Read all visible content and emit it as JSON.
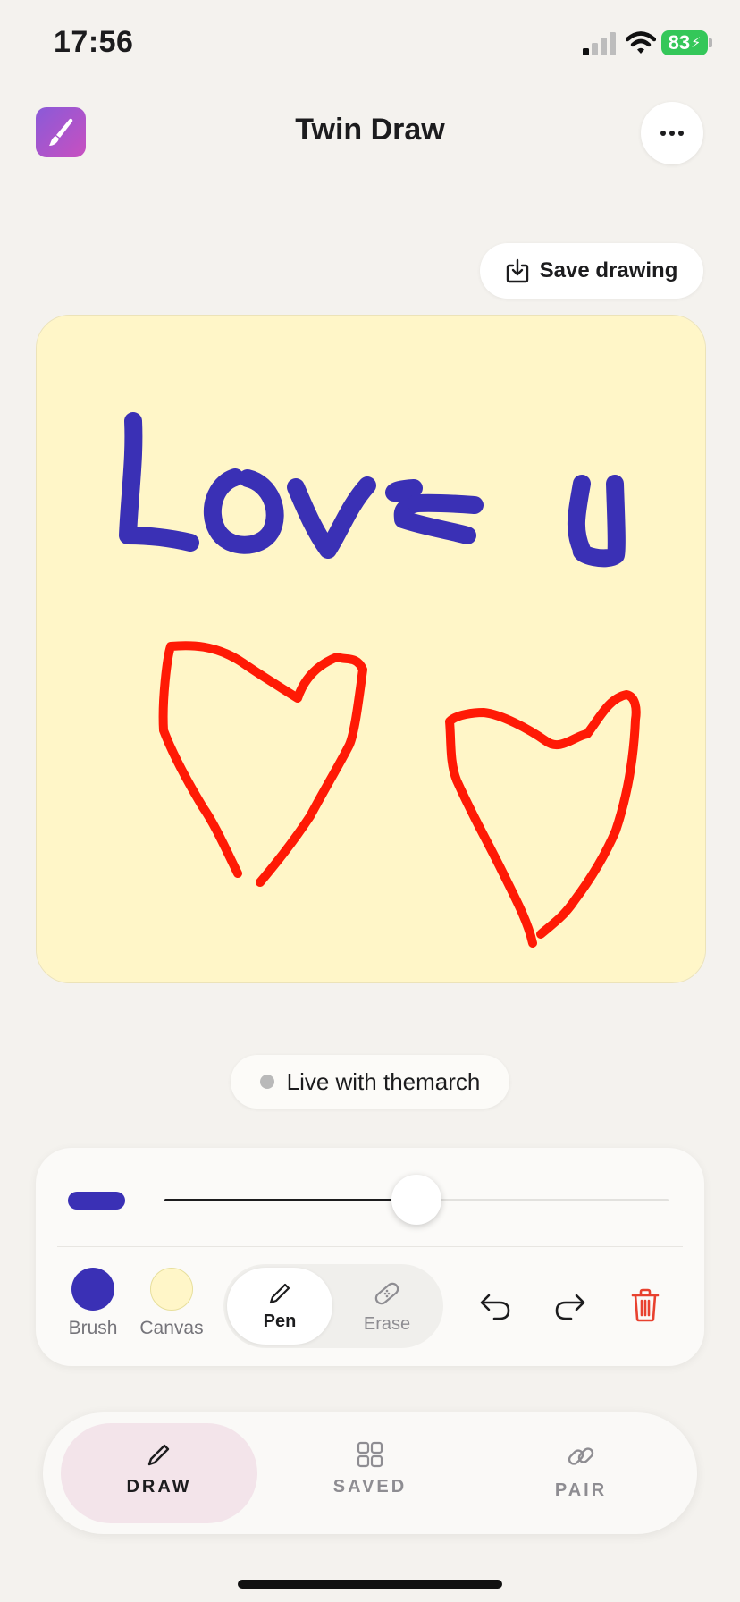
{
  "status_bar": {
    "time": "17:56",
    "battery": "83"
  },
  "header": {
    "title": "Twin Draw",
    "app_icon": "paintbrush-icon",
    "more_icon": "ellipsis-icon"
  },
  "save_button": {
    "label": "Save drawing",
    "icon": "download-tray-icon"
  },
  "canvas": {
    "background": "#fff6c8",
    "text_stroke_color": "#3a30b5",
    "heart_stroke_color": "#ff1a05"
  },
  "live_status": {
    "label": "Live with themarch",
    "dot_color": "#b9b9b9"
  },
  "tools": {
    "brush_size_fraction": 0.5,
    "brush_color": "#3a30b5",
    "canvas_color": "#fff6c8",
    "brush_label": "Brush",
    "canvas_label": "Canvas",
    "pen_label": "Pen",
    "erase_label": "Erase",
    "selected_mode": "Pen",
    "undo_icon": "undo-icon",
    "redo_icon": "redo-icon",
    "delete_icon": "trash-icon",
    "delete_color": "#e8412f"
  },
  "tabbar": {
    "tabs": [
      {
        "label": "DRAW",
        "icon": "pencil-icon",
        "active": true
      },
      {
        "label": "SAVED",
        "icon": "grid-icon",
        "active": false
      },
      {
        "label": "PAIR",
        "icon": "link-icon",
        "active": false
      }
    ]
  }
}
